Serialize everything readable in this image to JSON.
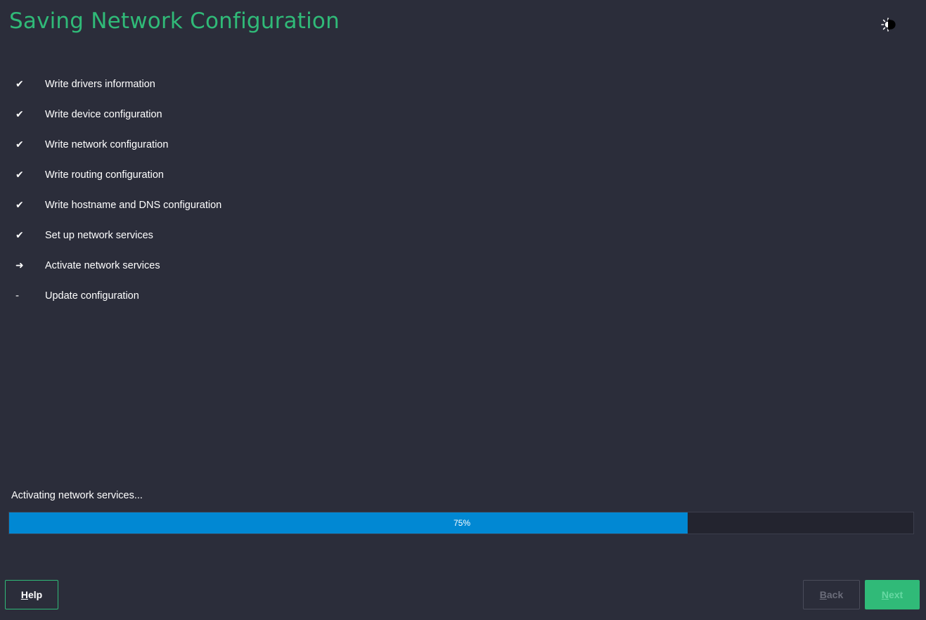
{
  "header": {
    "title": "Saving Network Configuration"
  },
  "steps": [
    {
      "marker": "✔",
      "label": "Write drivers information",
      "status": "done"
    },
    {
      "marker": "✔",
      "label": "Write device configuration",
      "status": "done"
    },
    {
      "marker": "✔",
      "label": "Write network configuration",
      "status": "done"
    },
    {
      "marker": "✔",
      "label": "Write routing configuration",
      "status": "done"
    },
    {
      "marker": "✔",
      "label": "Write hostname and DNS configuration",
      "status": "done"
    },
    {
      "marker": "✔",
      "label": "Set up network services",
      "status": "done"
    },
    {
      "marker": "➜",
      "label": "Activate network services",
      "status": "current"
    },
    {
      "marker": "-",
      "label": "Update configuration",
      "status": "pending"
    }
  ],
  "progress": {
    "label": "Activating network services...",
    "percent": 75,
    "text": "75%"
  },
  "buttons": {
    "help": {
      "mnemonic": "H",
      "rest": "elp"
    },
    "back": {
      "mnemonic": "B",
      "rest": "ack"
    },
    "next": {
      "mnemonic": "N",
      "rest": "ext"
    }
  },
  "icons": {
    "theme_toggle": "brightness-contrast-icon"
  },
  "colors": {
    "background": "#2b2d3a",
    "accent": "#30ba78",
    "progress_fill": "#0188d3"
  }
}
